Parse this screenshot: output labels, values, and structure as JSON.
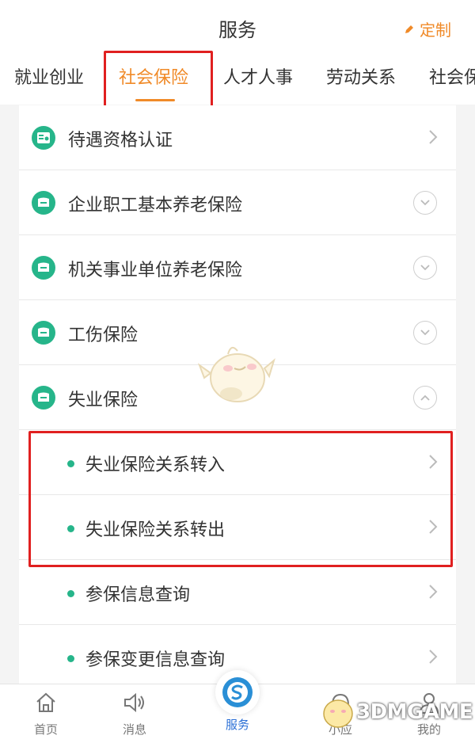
{
  "header": {
    "title": "服务",
    "customize_label": "定制"
  },
  "tabs": [
    {
      "label": "就业创业",
      "active": false
    },
    {
      "label": "社会保险",
      "active": true
    },
    {
      "label": "人才人事",
      "active": false
    },
    {
      "label": "劳动关系",
      "active": false
    },
    {
      "label": "社会保",
      "active": false
    }
  ],
  "list": {
    "categories": [
      {
        "label": "待遇资格认证",
        "control": "chevron-right"
      },
      {
        "label": "企业职工基本养老保险",
        "control": "expand-down"
      },
      {
        "label": "机关事业单位养老保险",
        "control": "expand-down"
      },
      {
        "label": "工伤保险",
        "control": "expand-down"
      },
      {
        "label": "失业保险",
        "control": "collapse-up"
      }
    ],
    "sub_items": [
      {
        "label": "失业保险关系转入"
      },
      {
        "label": "失业保险关系转出"
      },
      {
        "label": "参保信息查询"
      },
      {
        "label": "参保变更信息查询"
      }
    ]
  },
  "bottom_nav": [
    {
      "label": "首页",
      "icon": "home-icon"
    },
    {
      "label": "消息",
      "icon": "speaker-icon"
    },
    {
      "label": "服务",
      "icon": "service-icon",
      "active": true
    },
    {
      "label": "小应",
      "icon": "headset-icon"
    },
    {
      "label": "我的",
      "icon": "user-icon"
    }
  ],
  "watermark": {
    "text": "3DMGAME"
  },
  "colors": {
    "accent": "#f08a28",
    "green": "#26b58a",
    "highlight": "#e02020",
    "nav_active": "#2a6fd6"
  }
}
